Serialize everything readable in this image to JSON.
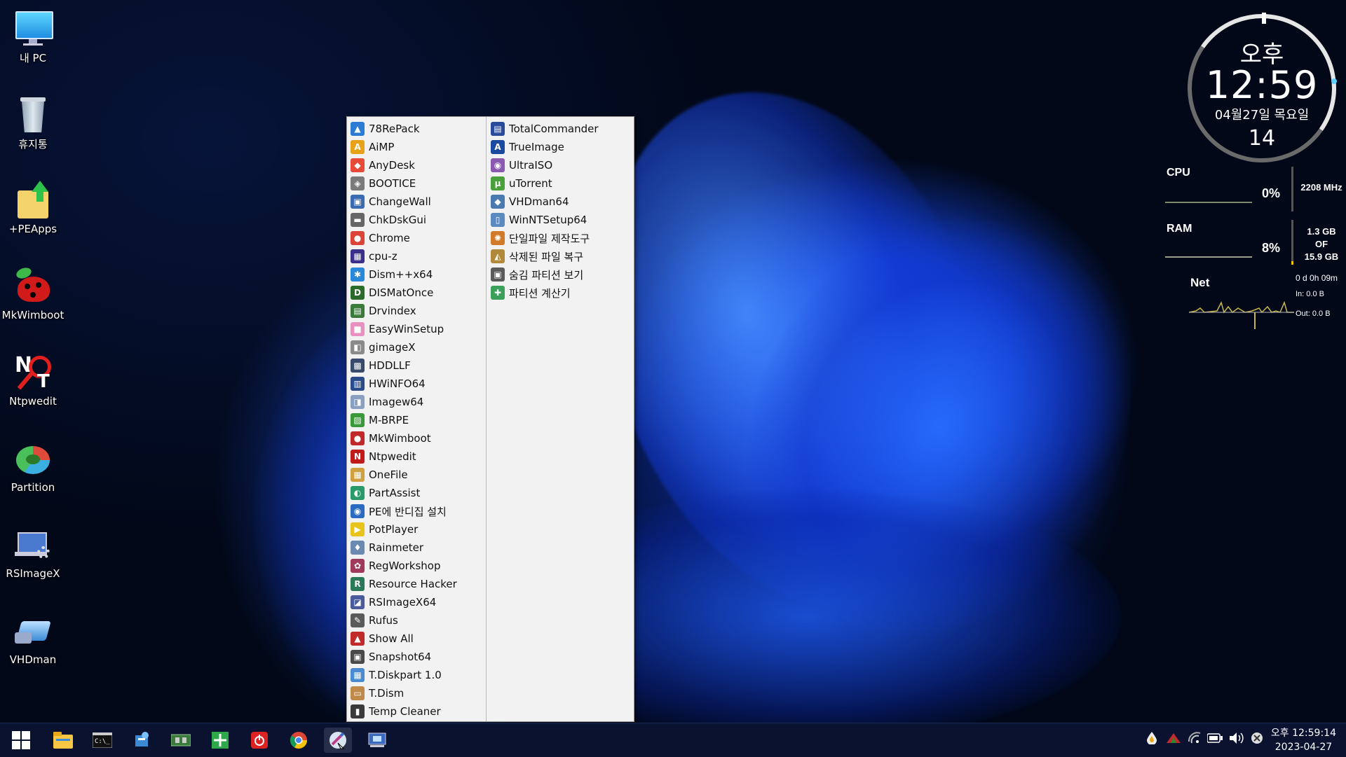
{
  "desktop": {
    "icons": [
      {
        "label": "내 PC",
        "icon": "monitor-icon"
      },
      {
        "label": "휴지통",
        "icon": "recycle-bin-icon"
      },
      {
        "label": "+PEApps",
        "icon": "folder-arrow-icon"
      },
      {
        "label": "MkWimboot",
        "icon": "ladybug-icon"
      },
      {
        "label": "Ntpwedit",
        "icon": "key-icon"
      },
      {
        "label": "Partition",
        "icon": "disk-icon"
      },
      {
        "label": "RSImageX",
        "icon": "laptop-gear-icon"
      },
      {
        "label": "VHDman",
        "icon": "vhd-icon"
      }
    ]
  },
  "menu": {
    "left": [
      {
        "label": "78RePack",
        "color": "#2e7bd6",
        "glyph": "▲"
      },
      {
        "label": "AiMP",
        "color": "#e8a21a",
        "glyph": "A"
      },
      {
        "label": "AnyDesk",
        "color": "#e84a3a",
        "glyph": "◆"
      },
      {
        "label": "BOOTICE",
        "color": "#7a7a7a",
        "glyph": "◈"
      },
      {
        "label": "ChangeWall",
        "color": "#3a6bb0",
        "glyph": "▣"
      },
      {
        "label": "ChkDskGui",
        "color": "#666666",
        "glyph": "▬"
      },
      {
        "label": "Chrome",
        "color": "#db4437",
        "glyph": "●"
      },
      {
        "label": "cpu-z",
        "color": "#3a2f8a",
        "glyph": "▦"
      },
      {
        "label": "Dism++x64",
        "color": "#2a88d8",
        "glyph": "✱"
      },
      {
        "label": "DISMatOnce",
        "color": "#2a6a2a",
        "glyph": "D"
      },
      {
        "label": "Drvindex",
        "color": "#3a7a3a",
        "glyph": "▤"
      },
      {
        "label": "EasyWinSetup",
        "color": "#e890c0",
        "glyph": "■"
      },
      {
        "label": "gimageX",
        "color": "#8a8a8a",
        "glyph": "◧"
      },
      {
        "label": "HDDLLF",
        "color": "#3a4a6a",
        "glyph": "▩"
      },
      {
        "label": "HWiNFO64",
        "color": "#2a4a8a",
        "glyph": "▥"
      },
      {
        "label": "Imagew64",
        "color": "#8aa0c0",
        "glyph": "◨"
      },
      {
        "label": "M-BRPE",
        "color": "#3a9a3a",
        "glyph": "▨"
      },
      {
        "label": "MkWimboot",
        "color": "#c0282a",
        "glyph": "●"
      },
      {
        "label": "Ntpwedit",
        "color": "#c01a1a",
        "glyph": "N"
      },
      {
        "label": "OneFile",
        "color": "#d0a040",
        "glyph": "▦"
      },
      {
        "label": "PartAssist",
        "color": "#2a9a6a",
        "glyph": "◐"
      },
      {
        "label": "PE에 반디집 설치",
        "color": "#2a6ac0",
        "glyph": "◉"
      },
      {
        "label": "PotPlayer",
        "color": "#e8c41a",
        "glyph": "▶"
      },
      {
        "label": "Rainmeter",
        "color": "#6a8ab0",
        "glyph": "♦"
      },
      {
        "label": "RegWorkshop",
        "color": "#a03a5a",
        "glyph": "✿"
      },
      {
        "label": "Resource Hacker",
        "color": "#2a7a5a",
        "glyph": "R"
      },
      {
        "label": "RSImageX64",
        "color": "#4a5a9a",
        "glyph": "◪"
      },
      {
        "label": "Rufus",
        "color": "#5a5a5a",
        "glyph": "✎"
      },
      {
        "label": "Show All",
        "color": "#c02a2a",
        "glyph": "▲"
      },
      {
        "label": "Snapshot64",
        "color": "#4a4a4a",
        "glyph": "▣"
      },
      {
        "label": "T.Diskpart 1.0",
        "color": "#4a8ad0",
        "glyph": "▦"
      },
      {
        "label": "T.Dism",
        "color": "#c08a4a",
        "glyph": "▭"
      },
      {
        "label": "Temp Cleaner",
        "color": "#3a3a3a",
        "glyph": "▮"
      }
    ],
    "right": [
      {
        "label": "TotalCommander",
        "color": "#2a4a9a",
        "glyph": "▤"
      },
      {
        "label": "TrueImage",
        "color": "#1a4aa0",
        "glyph": "A"
      },
      {
        "label": "UltraISO",
        "color": "#8a5ab0",
        "glyph": "◉"
      },
      {
        "label": "uTorrent",
        "color": "#4aa03a",
        "glyph": "µ"
      },
      {
        "label": "VHDman64",
        "color": "#4a7ab0",
        "glyph": "◆"
      },
      {
        "label": "WinNTSetup64",
        "color": "#5a8ac0",
        "glyph": "▯"
      },
      {
        "label": "단일파일 제작도구",
        "color": "#d07a2a",
        "glyph": "✺"
      },
      {
        "label": "삭제된 파일 복구",
        "color": "#b08a3a",
        "glyph": "◭"
      },
      {
        "label": "숨김 파티션 보기",
        "color": "#5a5a5a",
        "glyph": "▣"
      },
      {
        "label": "파티션 계산기",
        "color": "#3aa05a",
        "glyph": "✚"
      }
    ]
  },
  "clock_widget": {
    "ampm": "오후",
    "time": "12:59",
    "date": "04월27일 목요일",
    "seconds": "14"
  },
  "sysmon": {
    "cpu_label": "CPU",
    "cpu_pct": "0%",
    "cpu_freq": "2208 MHz",
    "ram_label": "RAM",
    "ram_pct": "8%",
    "ram_used": "1.3 GB",
    "ram_of": "OF",
    "ram_total": "15.9 GB",
    "net_label": "Net",
    "uptime": "0 d 0h 09m",
    "net_in": "In: 0.0 B",
    "net_out": "Out: 0.0 B"
  },
  "taskbar": {
    "buttons": [
      "start-icon",
      "file-explorer-icon",
      "terminal-icon",
      "network-app-icon",
      "hardware-icon",
      "spreadsheet-icon",
      "power-icon",
      "chrome-icon",
      "launcher-icon",
      "vhd-tool-icon"
    ],
    "time": "오후 12:59:14",
    "date": "2023-04-27"
  }
}
